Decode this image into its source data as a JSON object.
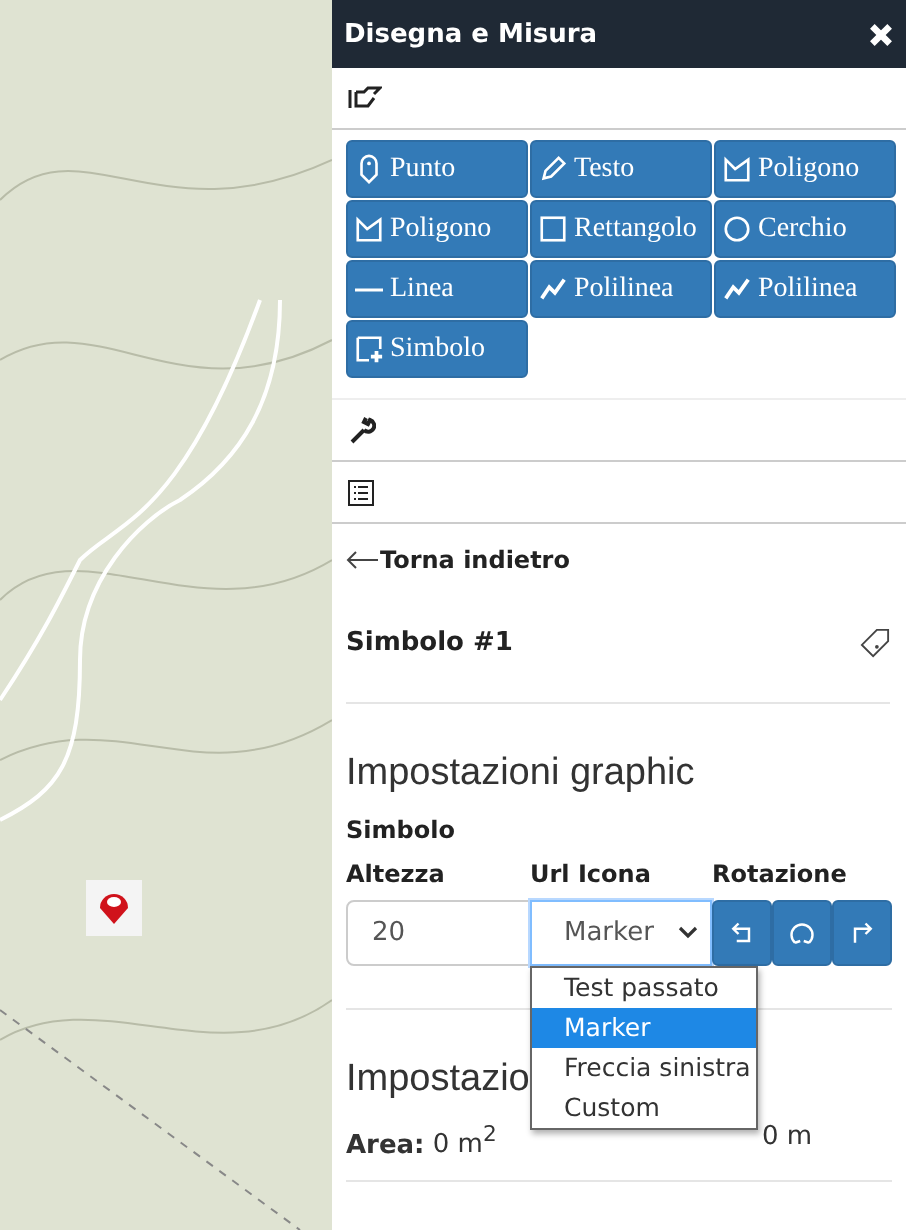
{
  "panel": {
    "title": "Disegna e Misura"
  },
  "tools": [
    {
      "kind": "marker",
      "label": "Punto"
    },
    {
      "kind": "pencil",
      "label": "Testo"
    },
    {
      "kind": "polygon",
      "label": "Poligono"
    },
    {
      "kind": "polygon",
      "label": "Poligono"
    },
    {
      "kind": "square",
      "label": "Rettangolo"
    },
    {
      "kind": "circle",
      "label": "Cerchio"
    },
    {
      "kind": "line",
      "label": "Linea"
    },
    {
      "kind": "polyline",
      "label": "Polilinea"
    },
    {
      "kind": "polyline",
      "label": "Polilinea"
    },
    {
      "kind": "symbol",
      "label": "Simbolo"
    }
  ],
  "back_link": "Torna indietro",
  "feature": {
    "name": "Simbolo #1"
  },
  "graphic": {
    "heading": "Impostazioni graphic",
    "subheading": "Simbolo",
    "height_label": "Altezza",
    "icon_label": "Url Icona",
    "rotation_label": "Rotazione",
    "height_value": "20",
    "icon_value": "Marker",
    "icon_options": [
      {
        "label": "Test passato",
        "selected": false
      },
      {
        "label": "Marker",
        "selected": true
      },
      {
        "label": "Freccia sinistra",
        "selected": false
      },
      {
        "label": "Custom",
        "selected": false
      }
    ],
    "rotation_buttons": [
      {
        "kind": "left"
      },
      {
        "kind": "reset"
      },
      {
        "kind": "right"
      }
    ]
  },
  "measure": {
    "heading": "Impostazio",
    "area_label": "Area:",
    "area_value": "0 m$^{2}$",
    "perimeter_value": "0 m"
  }
}
